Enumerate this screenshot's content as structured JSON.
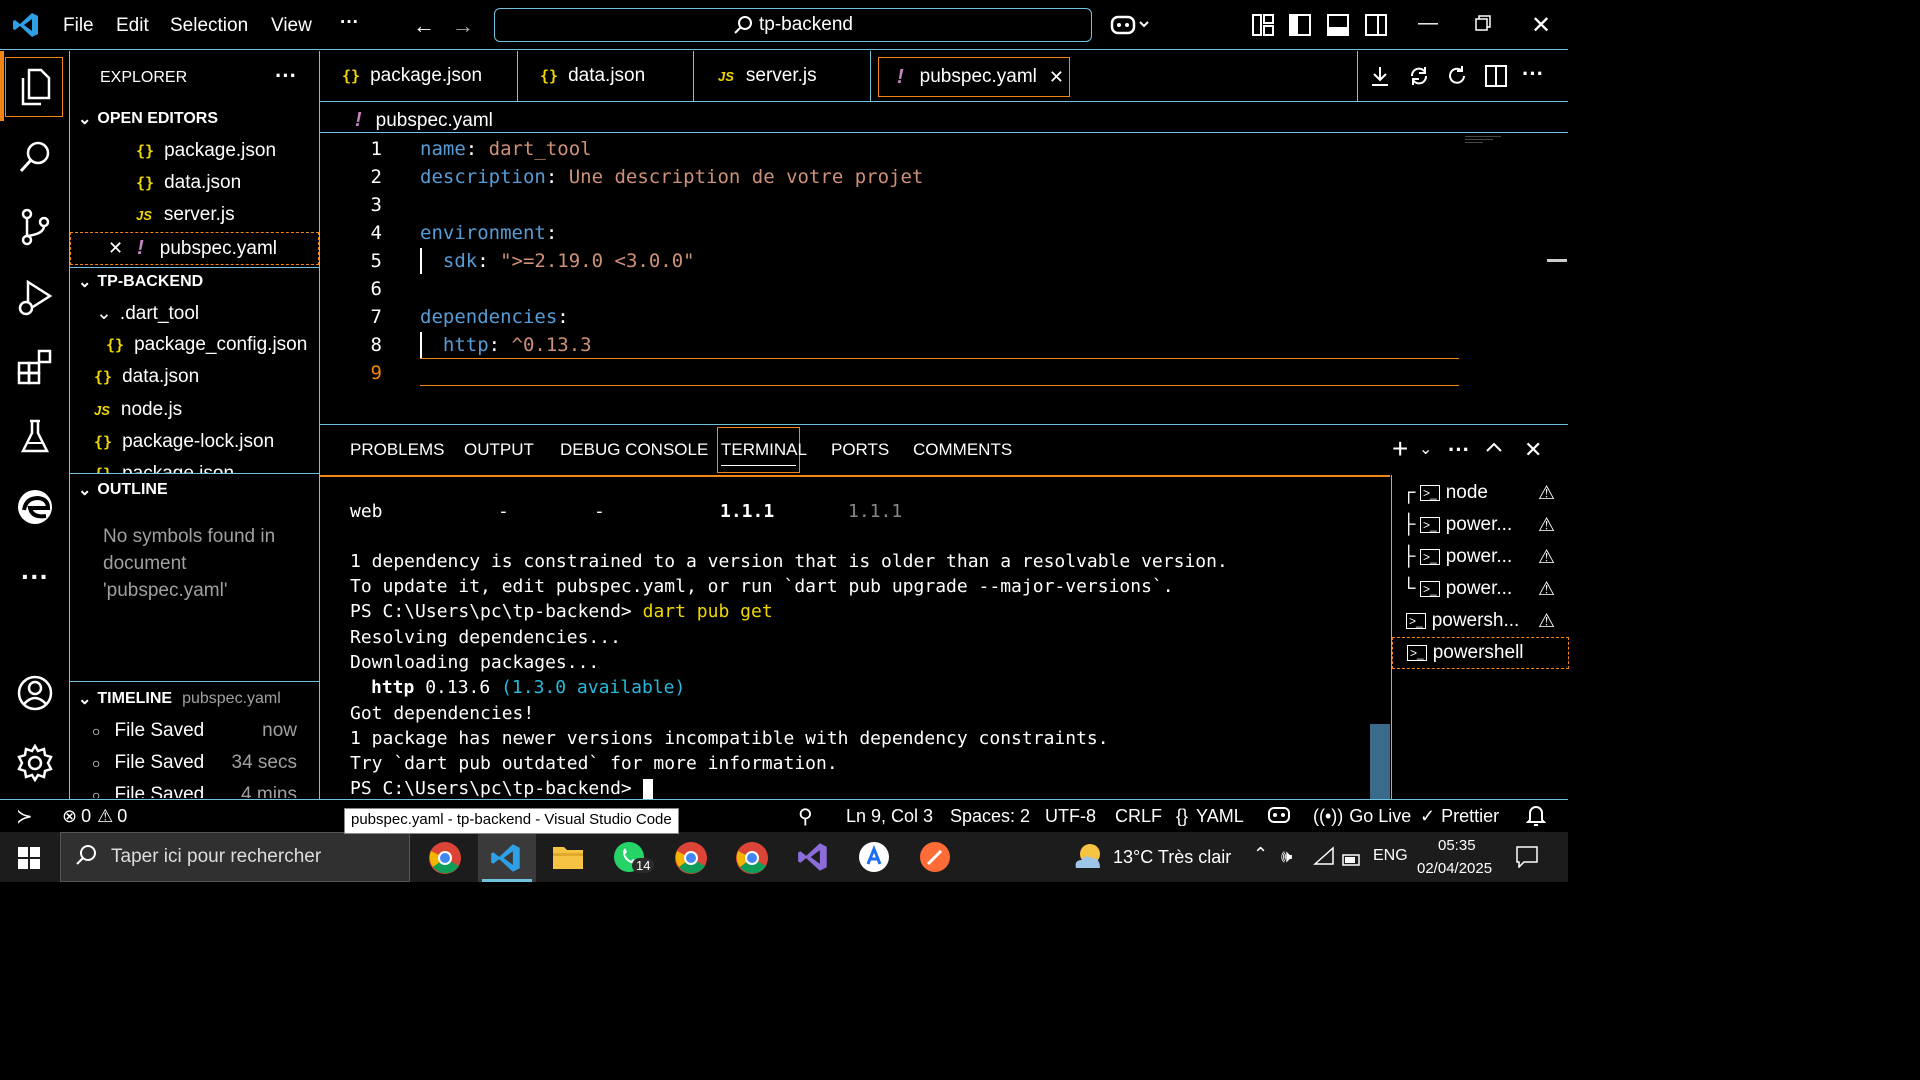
{
  "titlebar": {
    "menus": [
      "File",
      "Edit",
      "Selection",
      "View"
    ],
    "more": "···",
    "search": "tp-backend"
  },
  "sidebar": {
    "explorer_title": "EXPLORER",
    "open_editors_title": "OPEN EDITORS",
    "open_editors": [
      {
        "name": "package.json",
        "type": "json"
      },
      {
        "name": "data.json",
        "type": "json"
      },
      {
        "name": "server.js",
        "type": "js"
      },
      {
        "name": "pubspec.yaml",
        "type": "yaml"
      }
    ],
    "project_title": "TP-BACKEND",
    "project": [
      {
        "name": ".dart_tool",
        "type": "folder"
      },
      {
        "name": "package_config.json",
        "type": "json"
      },
      {
        "name": "data.json",
        "type": "json"
      },
      {
        "name": "node.js",
        "type": "js"
      },
      {
        "name": "package-lock.json",
        "type": "json"
      },
      {
        "name": "package.json",
        "type": "json"
      }
    ],
    "outline_title": "OUTLINE",
    "outline_empty": [
      "No symbols found in",
      "document",
      "'pubspec.yaml'"
    ],
    "timeline_title": "TIMELINE",
    "timeline_file": "pubspec.yaml",
    "timeline": [
      {
        "label": "File Saved",
        "when": "now"
      },
      {
        "label": "File Saved",
        "when": "34 secs"
      },
      {
        "label": "File Saved",
        "when": "4 mins"
      }
    ]
  },
  "tabs": [
    {
      "name": "package.json",
      "icon": "{}"
    },
    {
      "name": "data.json",
      "icon": "{}"
    },
    {
      "name": "server.js",
      "icon": "JS"
    },
    {
      "name": "pubspec.yaml",
      "icon": "!"
    }
  ],
  "breadcrumb": "pubspec.yaml",
  "editor": {
    "lines": [
      {
        "n": "1",
        "key": "name",
        "sep": ": ",
        "val": "dart_tool",
        "indent": ""
      },
      {
        "n": "2",
        "key": "description",
        "sep": ": ",
        "val": "Une description de votre projet",
        "indent": ""
      },
      {
        "n": "3",
        "key": "",
        "sep": "",
        "val": "",
        "indent": ""
      },
      {
        "n": "4",
        "key": "environment",
        "sep": ":",
        "val": "",
        "indent": ""
      },
      {
        "n": "5",
        "key": "sdk",
        "sep": ": ",
        "val": "\">=2.19.0 <3.0.0\"",
        "indent": "  "
      },
      {
        "n": "6",
        "key": "",
        "sep": "",
        "val": "",
        "indent": ""
      },
      {
        "n": "7",
        "key": "dependencies",
        "sep": ":",
        "val": "",
        "indent": ""
      },
      {
        "n": "8",
        "key": "http",
        "sep": ": ",
        "val": "^0.13.3",
        "indent": "  "
      },
      {
        "n": "9",
        "key": "",
        "sep": "",
        "val": "",
        "indent": ""
      }
    ]
  },
  "panel": {
    "tabs": [
      "PROBLEMS",
      "OUTPUT",
      "DEBUG CONSOLE",
      "TERMINAL",
      "PORTS",
      "COMMENTS"
    ],
    "terminal": {
      "web_row": {
        "name": "web",
        "c1": "-",
        "c2": "-",
        "c3": "1.1.1",
        "c4": "1.1.1"
      },
      "lines": [
        "1 dependency is constrained to a version that is older than a resolvable version.",
        "To update it, edit pubspec.yaml, or run `dart pub upgrade --major-versions`."
      ],
      "prompt": "PS C:\\Users\\pc\\tp-backend> ",
      "cmd": "dart pub get",
      "after": [
        "Resolving dependencies...",
        "Downloading packages..."
      ],
      "http_name": "http",
      "http_ver": " 0.13.6 ",
      "http_avail": "(1.3.0 available)",
      "final": [
        "Got dependencies!",
        "1 package has newer versions incompatible with dependency constraints.",
        "Try `dart pub outdated` for more information."
      ],
      "last_prompt": "PS C:\\Users\\pc\\tp-backend> "
    },
    "terminals": [
      {
        "prefix": "┌",
        "name": "node",
        "warn": true
      },
      {
        "prefix": "├",
        "name": "power...",
        "warn": true
      },
      {
        "prefix": "├",
        "name": "power...",
        "warn": true
      },
      {
        "prefix": "└",
        "name": "power...",
        "warn": true
      },
      {
        "prefix": "",
        "name": "powersh...",
        "warn": true
      },
      {
        "prefix": "",
        "name": "powershell",
        "warn": false
      }
    ]
  },
  "status": {
    "errors": "0",
    "warnings": "0",
    "tooltip": "pubspec.yaml - tp-backend - Visual Studio Code",
    "position": "Ln 9, Col 3",
    "spaces": "Spaces: 2",
    "encoding": "UTF-8",
    "eol": "CRLF",
    "lang": "YAML",
    "golive": "Go Live",
    "prettier": "Prettier"
  },
  "taskbar": {
    "search": "Taper ici pour rechercher",
    "whatsapp_badge": "14",
    "weather": "13°C  Très clair",
    "lang": "ENG",
    "time": "05:35",
    "date": "02/04/2025"
  },
  "colors": {
    "accent": "#6fc3df",
    "active": "#f38518",
    "keyword": "#569cd6",
    "string": "#ce9178",
    "json": "#f1d700",
    "yaml": "#c586c0"
  }
}
